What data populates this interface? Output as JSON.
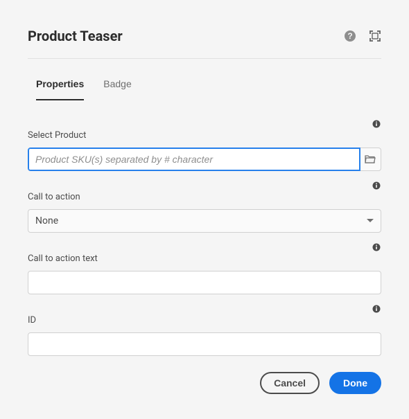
{
  "dialog": {
    "title": "Product Teaser"
  },
  "tabs": {
    "0": {
      "label": "Properties"
    },
    "1": {
      "label": "Badge"
    }
  },
  "fields": {
    "selectProduct": {
      "label": "Select Product",
      "placeholder": "Product SKU(s) separated by # character",
      "value": ""
    },
    "callToAction": {
      "label": "Call to action",
      "value": "None"
    },
    "callToActionText": {
      "label": "Call to action text",
      "value": ""
    },
    "id": {
      "label": "ID",
      "value": ""
    }
  },
  "footer": {
    "cancel": "Cancel",
    "done": "Done"
  }
}
